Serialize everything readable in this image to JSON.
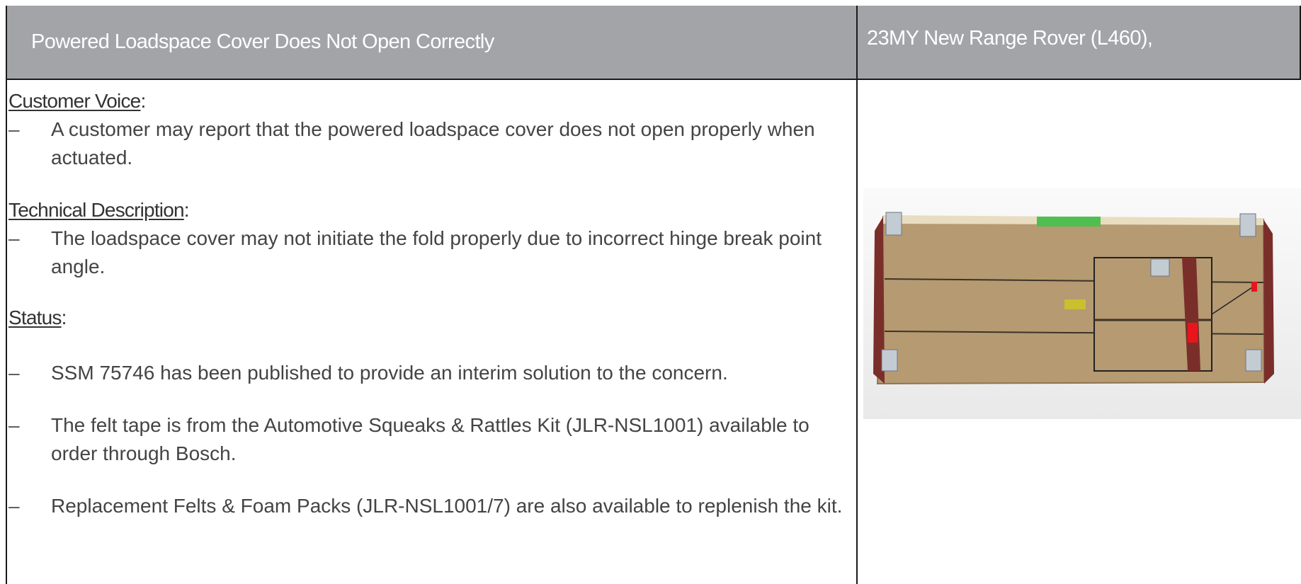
{
  "header": {
    "title": "Powered Loadspace Cover Does Not Open Correctly",
    "vehicle": "23MY New Range Rover (L460),"
  },
  "sections": {
    "customer_voice": {
      "heading": "Customer Voice",
      "bullets": [
        "A customer may report that the powered loadspace cover does not open properly when actuated."
      ]
    },
    "technical_description": {
      "heading": "Technical Description",
      "bullets": [
        "The loadspace cover may not initiate the fold properly due to incorrect hinge break point angle."
      ]
    },
    "status": {
      "heading": "Status",
      "bullets": [
        "SSM 75746 has been published to provide an interim solution to the concern.",
        "The felt tape is from the Automotive Squeaks & Rattles Kit (JLR-NSL1001) available to order through Bosch.",
        "Replacement Felts & Foam Packs (JLR-NSL1001/7) are also available to replenish the kit."
      ]
    }
  },
  "punctuation": {
    "colon": ":",
    "dash": "–"
  },
  "figure": {
    "colors": {
      "board": "#b59a72",
      "frame": "#7a2e2a",
      "tape": "#4fbf50",
      "felt_marker": "#e8161c",
      "pad": "#c9c02f"
    }
  }
}
